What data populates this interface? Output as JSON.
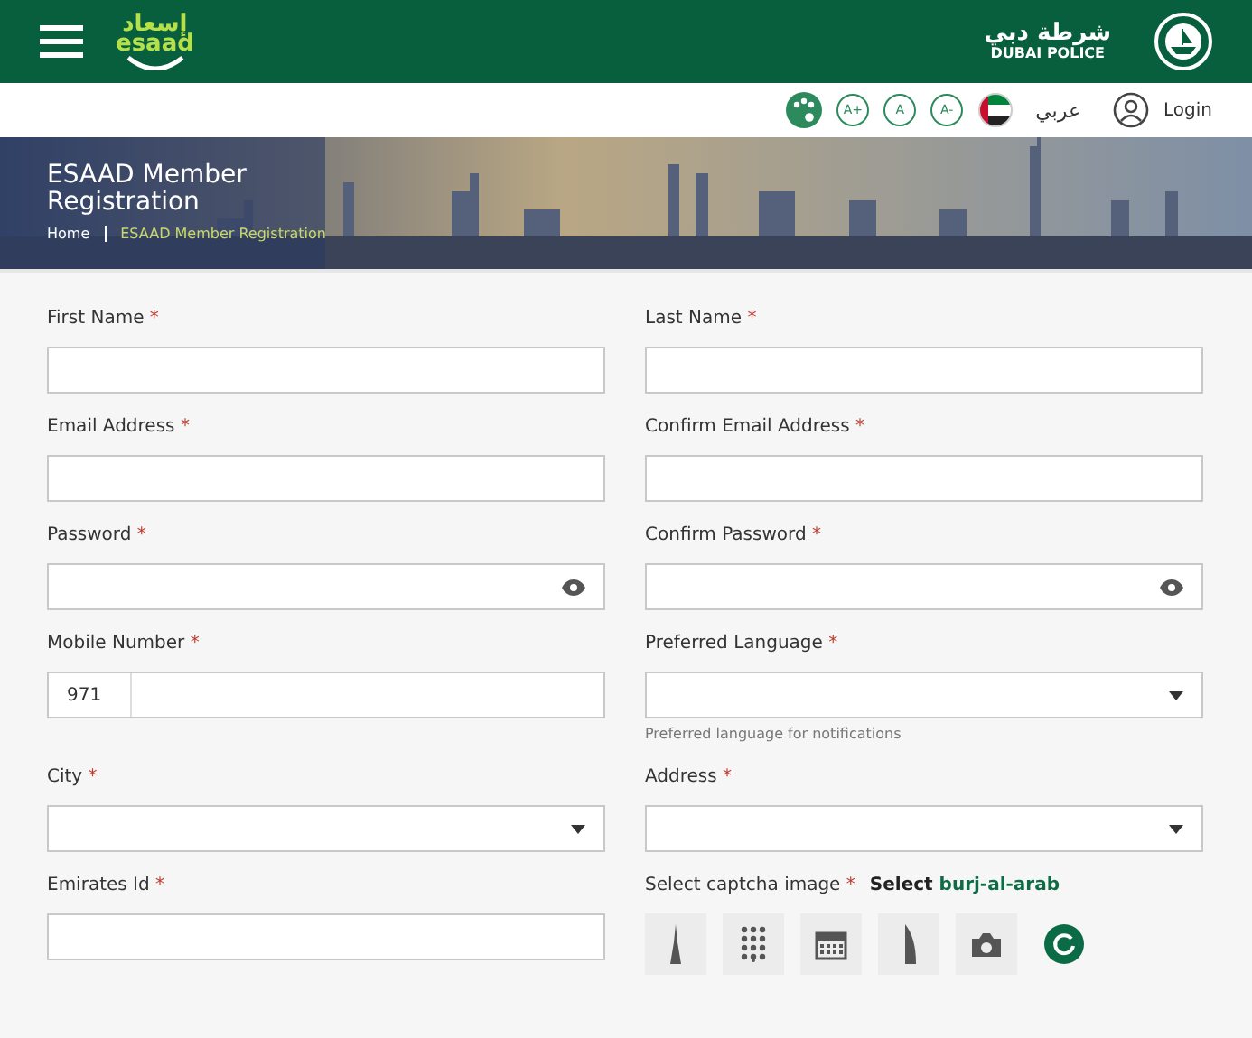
{
  "header": {
    "logo_arabic": "إسعاد",
    "logo_latin": "esaad",
    "police_arabic": "شرطة دبي",
    "police_latin": "DUBAI POLICE"
  },
  "toolbar": {
    "font_buttons": [
      "A+",
      "A",
      "A-"
    ],
    "language": "عربي",
    "login": "Login"
  },
  "banner": {
    "title": "ESAAD Member Registration",
    "breadcrumbs": [
      {
        "label": "Home",
        "current": false
      },
      {
        "label": "ESAAD Member Registration",
        "current": true
      }
    ]
  },
  "fields": [
    {
      "label": "First Name",
      "mark": "*",
      "kind": "text"
    },
    {
      "label": "Last Name",
      "mark": "*",
      "kind": "text"
    },
    {
      "label": "Email Address",
      "mark": "*",
      "kind": "text"
    },
    {
      "label": "Confirm Email Address",
      "mark": "*",
      "kind": "text"
    },
    {
      "label": "Password",
      "mark": "*",
      "kind": "password"
    },
    {
      "label": "Confirm Password",
      "mark": "*",
      "kind": "password"
    },
    {
      "label": "Mobile Number",
      "mark": "*",
      "kind": "phone",
      "prefix": "971"
    },
    {
      "label": "Preferred Language",
      "mark": "*",
      "kind": "select",
      "hint": "Preferred language for notifications"
    },
    {
      "label": "City",
      "mark": "*",
      "kind": "select"
    },
    {
      "label": "Address",
      "mark": "*",
      "kind": "select"
    },
    {
      "label": "Emirates Id",
      "mark": "*",
      "kind": "text"
    }
  ],
  "captcha": {
    "label": "Select captcha image",
    "mark": "*",
    "prompt": "Select",
    "target": "burj-al-arab",
    "images": [
      {
        "kind": "tower"
      },
      {
        "kind": "keypad"
      },
      {
        "kind": "calendar"
      },
      {
        "kind": "burj"
      },
      {
        "kind": "camera"
      },
      {
        "kind": "refresh"
      }
    ]
  }
}
